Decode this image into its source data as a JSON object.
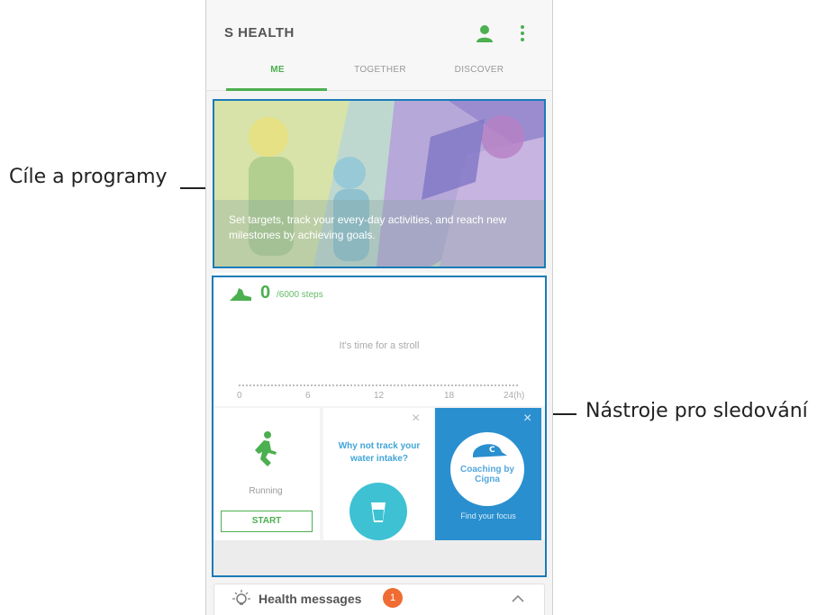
{
  "callouts": {
    "goals": "Cíle a programy",
    "trackers": "Nástroje pro sledování"
  },
  "app": {
    "title": "S HEALTH",
    "tabs": [
      {
        "label": "ME",
        "active": true
      },
      {
        "label": "TOGETHER",
        "active": false
      },
      {
        "label": "DISCOVER",
        "active": false
      }
    ],
    "icons": {
      "profile": "person-icon",
      "menu": "more-vertical-icon"
    }
  },
  "banner": {
    "text": "Set targets, track your every-day activities, and reach new milestones by achieving goals."
  },
  "steps": {
    "count": "0",
    "goal": "/6000 steps",
    "message": "It's time for a stroll",
    "ticks": [
      "0",
      "6",
      "12",
      "18",
      "24(h)"
    ]
  },
  "cards": {
    "running": {
      "label": "Running",
      "button": "START"
    },
    "water": {
      "question": "Why not track your water intake?"
    },
    "cigna": {
      "brand": "Coaching by Cigna",
      "cta": "Find your focus"
    }
  },
  "messages": {
    "label": "Health messages",
    "count": "1"
  },
  "colors": {
    "accent": "#4caf50",
    "frame": "#1a7bb8",
    "cigna": "#2a8fcf",
    "badge": "#ef6c33"
  }
}
